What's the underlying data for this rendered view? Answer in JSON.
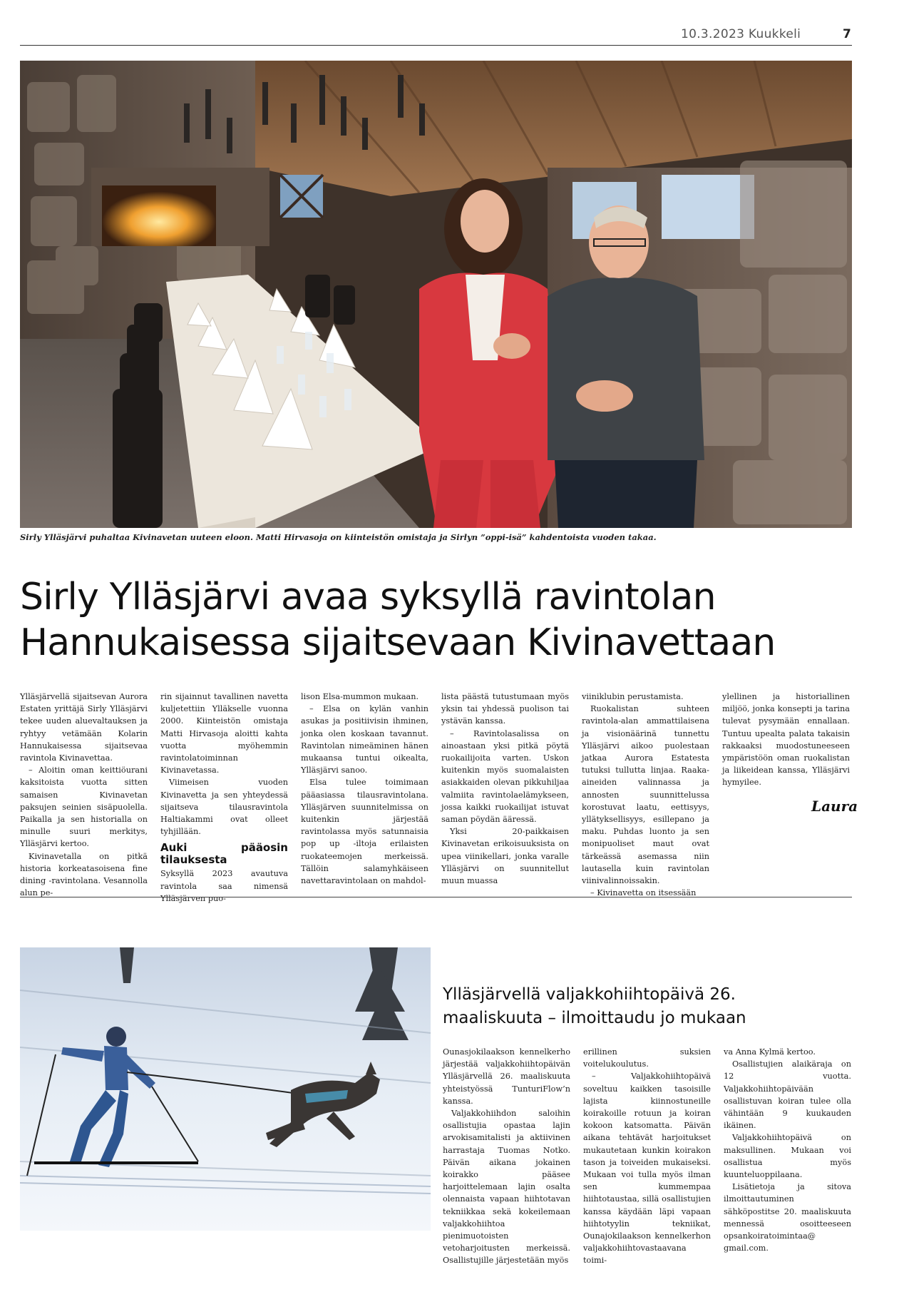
{
  "header": {
    "date_paper": "10.3.2023 Kuukkeli",
    "page_number": "7"
  },
  "article1": {
    "caption": "Sirly Ylläsjärvi puhaltaa Kivinavetan uuteen eloon. Matti Hirvasoja on kiinteistön omistaja ja Sirlyn ”oppi-isä” kahdentoista vuoden takaa.",
    "headline_line1": "Sirly Ylläsjärvi avaa syksyllä ravintolan",
    "headline_line2": "Hannukaisessa sijaitsevaan Kivinavettaan",
    "col1": [
      "Ylläsjärvellä sijaitsevan Aurora Estaten yrittäjä Sirly Ylläsjärvi tekee uuden aluevaltauksen ja ryhtyy vetämään Kolarin Hannukaisessa sijaitsevaa ravintola Kivinavettaa.",
      "– Aloitin oman keittiöurani kaksitoista vuotta sitten samaisen Kivinavetan paksujen seinien sisäpuolella. Paikalla ja sen historialla on minulle suuri merkitys, Ylläsjärvi kertoo.",
      "Kivinavetalla on pitkä historia korkeatasoisena fine dining -ravintolana. Vesannolla alun pe-"
    ],
    "col2a": [
      "rin sijainnut tavallinen navetta kuljetettiin Ylläkselle vuonna 2000. Kiinteistön omistaja Matti Hirvasoja aloitti kahta vuotta myöhemmin ravintolatoiminnan Kivinavetassa.",
      "Viimeisen vuoden Kivinavetta ja sen yhteydessä sijaitseva tilausravintola Haltiakammi ovat olleet tyhjillään."
    ],
    "subhead": "Auki pääosin tilauksesta",
    "col2b": "Syksyllä 2023 avautuva ravintola saa nimensä Ylläsjärven puo-",
    "col3": [
      "lison Elsa-mummon mukaan.",
      "– Elsa on kylän vanhin asukas ja positiivisin ihminen, jonka olen koskaan tavannut. Ravintolan nimeäminen hänen mukaansa tuntui oikealta, Ylläsjärvi sanoo.",
      "Elsa tulee toimimaan pääasiassa tilausravintolana. Ylläsjärven suunnitelmissa on kuitenkin järjestää ravintolassa myös satunnaisia pop up -iltoja erilaisten ruokateemojen merkeissä. Tällöin salamyhkäiseen navettaravintolaan on mahdol-"
    ],
    "col4": [
      "lista päästä tutustumaan myös yksin tai yhdessä puolison tai ystävän kanssa.",
      "– Ravintolasalissa on ainoastaan yksi pitkä pöytä ruokailijoita varten. Uskon kuitenkin myös suomalaisten asiakkaiden olevan pikkuhiljaa valmiita ravintolaelämykseen, jossa kaikki ruokailijat istuvat saman pöydän ääressä.",
      "Yksi 20-paikkaisen Kivinavetan erikoisuuksista on upea viinikellari, jonka varalle Ylläsjärvi on suunnitellut muun muassa"
    ],
    "col5": [
      "viiniklubin perustamista.",
      "Ruokalistan suhteen ravintola-alan ammattilaisena ja visionäärinä tunnettu Ylläsjärvi aikoo puolestaan jatkaa Aurora Estatesta tutuksi tullutta linjaa. Raaka-aineiden valinnassa ja annosten suunnittelussa korostuvat laatu, eettisyys, yllätyksellisyys, esillepano ja maku. Puhdas luonto ja sen monipuoliset maut ovat tärkeässä asemassa niin lautasella kuin ravintolan viinivalinnoissakin.",
      "– Kivinavetta on itsessään"
    ],
    "col6": [
      "ylellinen ja historiallinen miljöö, jonka konsepti ja tarina tulevat pysymään ennallaan. Tuntuu upealta palata takaisin rakkaaksi muodostuneeseen ympäristöön oman ruokalistan ja liikeidean kanssa, Ylläsjärvi hymyilee."
    ],
    "signature": "Laura"
  },
  "article2": {
    "headline_line1": "Ylläsjärvellä valjakkohiihtopäivä 26.",
    "headline_line2": "maaliskuuta – ilmoittaudu jo mukaan",
    "col1": [
      "Ounasjokilaakson kennelkerho järjestää valjakkohiihtopäivän Ylläsjärvellä 26. maaliskuuta yhteistyössä TunturiFlow’n kanssa.",
      "Valjakkohiihdon saloihin osallistujia opastaa lajin arvokisamitalisti ja aktiivinen harrastaja Tuomas Notko. Päivän aikana jokainen koirakko pääsee harjoittelemaan lajin osalta olennaista vapaan hiihtotavan tekniikkaa sekä kokeilemaan valjakkohiihtoa pienimuotoisten vetoharjoitusten merkeissä. Osallistujille järjestetään myös"
    ],
    "col2": [
      "erillinen suksien voitelukoulutus.",
      "– Valjakkohiihtopäivä soveltuu kaikken tasoisille lajista kiinnostuneille koirakoille rotuun ja koiran kokoon katsomatta. Päivän aikana tehtävät harjoitukset mukautetaan kunkin koirakon tason ja toiveiden mukaiseksi. Mukaan voi tulla myös ilman sen kummempaa hiihtotaustaa, sillä osallistujien kanssa käydään läpi vapaan hiihtotyylin tekniikat, Ounajokilaakson kennelkerhon valjakkohiihtovastaavana toimi-"
    ],
    "col3": [
      "va Anna Kylmä kertoo.",
      "Osallistujien alaikäraja on 12 vuotta. Valjakkohiihtopäivään osallistuvan koiran tulee olla vähintään 9 kuukauden ikäinen.",
      "Valjakkohiihtopäivä on maksullinen. Mukaan voi osallistua myös kuunteluoppilaana.",
      "Lisätietoja ja sitova ilmoittautuminen sähköpostitse 20. maaliskuuta mennessä osoitteeseen opsankoiratoimintaa@ gmail.com."
    ]
  },
  "colors": {
    "accent_red": "#d8383f",
    "rule": "#333333"
  }
}
